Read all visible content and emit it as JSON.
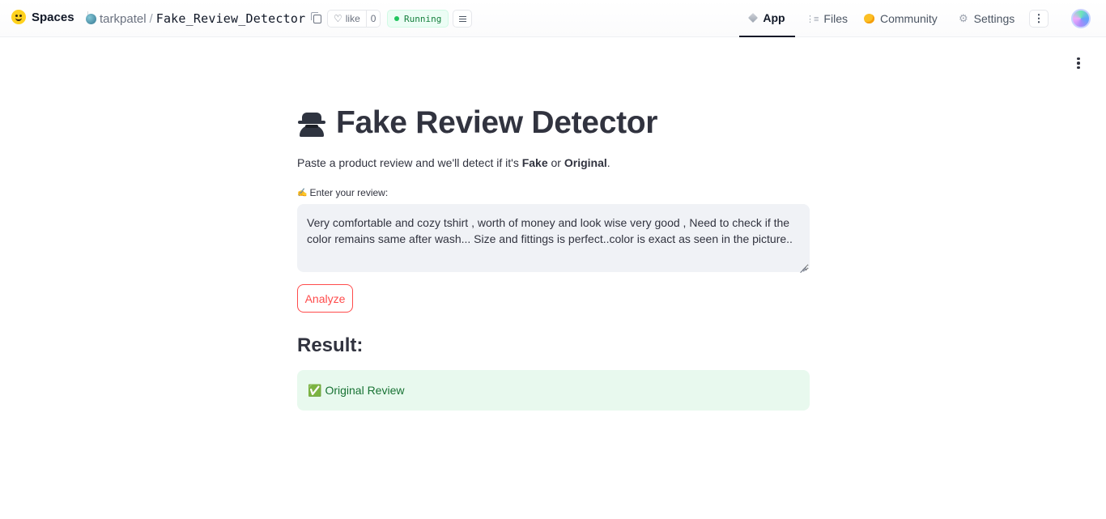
{
  "header": {
    "brand": "Spaces",
    "owner": "tarkpatel",
    "slash": "/",
    "repo": "Fake_Review_Detector",
    "like_label": "like",
    "like_count": "0",
    "status": "Running",
    "nav": [
      {
        "label": "App",
        "icon": "cube-icon"
      },
      {
        "label": "Files",
        "icon": "files-icon"
      },
      {
        "label": "Community",
        "icon": "community-icon"
      },
      {
        "label": "Settings",
        "icon": "gear-icon"
      }
    ]
  },
  "app": {
    "title": "Fake Review Detector",
    "subtitle_prefix": "Paste a product review and we'll detect if it's ",
    "subtitle_fake": "Fake",
    "subtitle_or": " or ",
    "subtitle_original": "Original",
    "subtitle_end": ".",
    "review_label": "Enter your review:",
    "review_text": "Very comfortable and cozy tshirt , worth of money and look wise very good , Need to check if the color remains same after wash... Size and fittings is perfect..color is exact as seen in the picture..",
    "analyze_label": "Analyze",
    "result_heading": "Result:",
    "result_text": "Original Review"
  },
  "colors": {
    "accent": "#ff4b4b",
    "success_bg": "#e8f9ee",
    "success_text": "#177233",
    "input_bg": "#f0f2f6",
    "running_green": "#22c55e"
  }
}
